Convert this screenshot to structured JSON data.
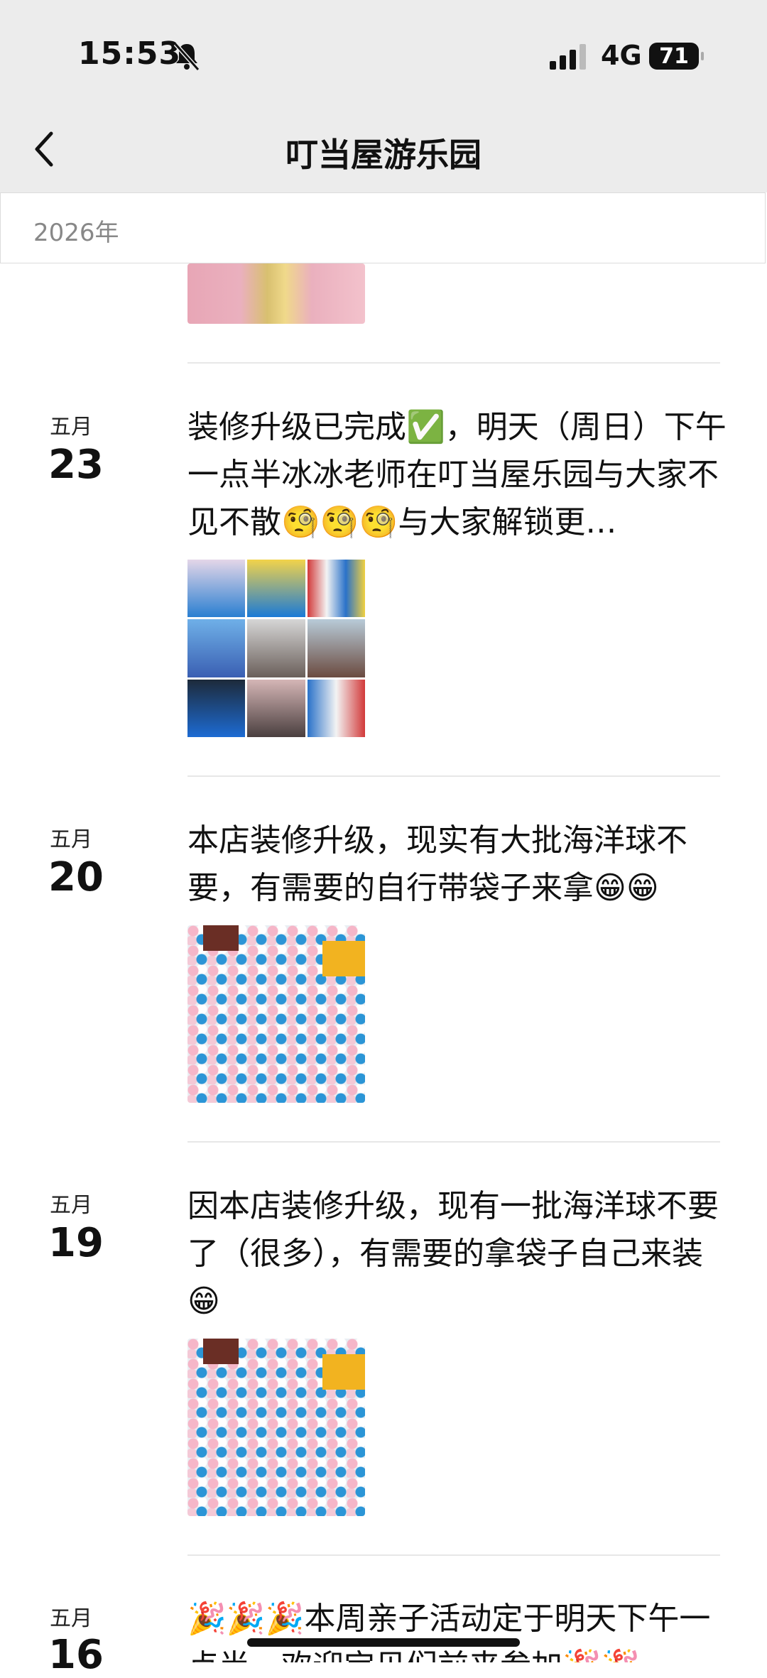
{
  "status": {
    "time": "15:53",
    "network": "4G",
    "battery": "71"
  },
  "nav": {
    "title": "叮当屋游乐园"
  },
  "year": "2026年",
  "posts": [
    {
      "month": "五月",
      "day": "23",
      "text": "装修升级已完成✅，明天（周日）下午一点半冰冰老师在叮当屋乐园与大家不见不散🧐🧐🧐与大家解锁更…"
    },
    {
      "month": "五月",
      "day": "20",
      "text": "本店装修升级，现实有大批海洋球不要，有需要的自行带袋子来拿😁😁"
    },
    {
      "month": "五月",
      "day": "19",
      "text": "因本店装修升级，现有一批海洋球不要了（很多），有需要的拿袋子自己来装😁"
    },
    {
      "month": "五月",
      "day": "16",
      "text": "🎉🎉🎉本周亲子活动定于明天下午一点半，欢迎宝贝们前来参加🎉🎉"
    }
  ]
}
